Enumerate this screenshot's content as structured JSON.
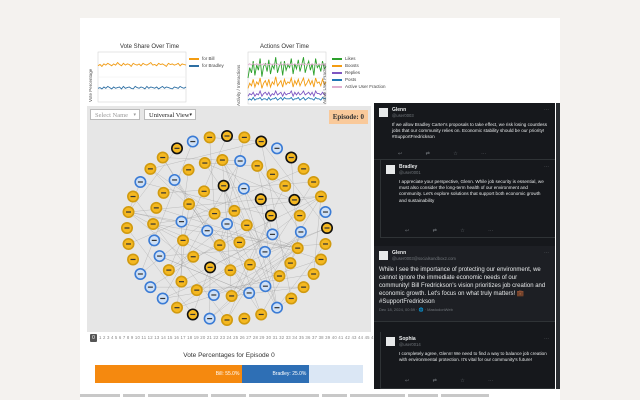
{
  "charts": {
    "vote_share": {
      "title": "Vote Share Over Time",
      "ylabel": "Vote Percentage",
      "legend": [
        "for Bill",
        "for Bradley"
      ],
      "colors": [
        "#f39c12",
        "#2e6fa3"
      ],
      "series": [
        [
          58,
          60,
          57,
          61,
          59,
          62,
          60,
          58,
          61,
          59,
          63,
          60,
          58,
          62,
          59,
          61,
          60,
          57,
          62,
          60,
          59,
          61,
          58,
          62,
          60,
          59,
          61,
          63,
          59,
          60,
          58,
          62,
          60,
          61,
          59,
          57,
          62,
          60,
          61,
          59,
          60,
          62,
          58,
          61,
          60,
          59
        ],
        [
          22,
          23,
          21,
          24,
          22,
          25,
          23,
          21,
          24,
          22,
          23,
          24,
          21,
          25,
          22,
          23,
          24,
          22,
          21,
          25,
          23,
          22,
          24,
          23,
          21,
          25,
          22,
          24,
          23,
          22,
          24,
          21,
          23,
          25,
          22,
          24,
          23,
          22,
          21,
          24,
          23,
          22,
          25,
          23,
          22,
          24
        ]
      ]
    },
    "actions": {
      "title": "Actions Over Time",
      "ylabel": "Activity / Interactions",
      "ylabel2": "Active User Fraction",
      "legend": [
        "Likes",
        "Boosts",
        "Replies",
        "Posts",
        "Active User Fraction"
      ],
      "colors": [
        "#2ca02c",
        "#f39c12",
        "#7e57c2",
        "#1f77b4",
        "#e0b0d0"
      ],
      "series": [
        [
          20,
          28,
          24,
          33,
          22,
          30,
          26,
          35,
          21,
          29,
          31,
          25,
          34,
          23,
          30,
          27,
          36,
          24,
          29,
          32,
          22,
          33,
          26,
          30,
          28,
          35,
          23,
          31,
          27,
          34,
          25,
          30,
          36,
          24,
          29,
          33,
          26,
          31,
          22,
          35,
          28,
          30,
          25,
          33,
          27,
          29
        ],
        [
          12,
          16,
          14,
          19,
          13,
          17,
          15,
          20,
          12,
          16,
          18,
          14,
          19,
          13,
          17,
          15,
          21,
          14,
          16,
          18,
          13,
          19,
          15,
          17,
          16,
          20,
          13,
          18,
          15,
          19,
          14,
          17,
          20,
          14,
          16,
          19,
          15,
          18,
          13,
          20,
          16,
          17,
          14,
          19,
          15,
          17
        ],
        [
          6,
          8,
          7,
          9,
          6,
          8,
          7,
          10,
          6,
          8,
          9,
          7,
          9,
          6,
          8,
          7,
          10,
          7,
          8,
          9,
          6,
          9,
          7,
          8,
          8,
          10,
          6,
          9,
          7,
          9,
          7,
          8,
          10,
          7,
          8,
          9,
          7,
          9,
          6,
          10,
          8,
          8,
          7,
          9,
          7,
          8
        ],
        [
          3,
          4,
          3,
          5,
          3,
          4,
          4,
          5,
          3,
          4,
          4,
          3,
          5,
          3,
          4,
          4,
          5,
          3,
          4,
          5,
          3,
          5,
          4,
          4,
          4,
          5,
          3,
          4,
          4,
          5,
          3,
          4,
          5,
          3,
          4,
          5,
          4,
          4,
          3,
          5,
          4,
          4,
          3,
          5,
          4,
          4
        ],
        [
          30,
          31,
          30,
          31,
          30,
          31,
          30,
          31,
          30,
          31,
          30,
          31,
          30,
          31,
          30,
          31,
          30,
          31,
          30,
          31,
          30,
          31,
          30,
          31,
          30,
          31,
          30,
          31,
          30,
          31,
          30,
          31,
          30,
          31,
          30,
          31,
          30,
          31,
          30,
          31,
          30,
          31,
          30,
          31,
          30,
          31
        ]
      ]
    }
  },
  "network": {
    "select_name": "Select Name",
    "view": "Universal View",
    "episode_label": "Episode: 0",
    "colors": {
      "bill": "#f5b820",
      "bradley": "#3a7bd5",
      "bg": "#e6e6e6",
      "edge": "#9a9a9a"
    }
  },
  "slider": {
    "current": "0",
    "marks": "1 2 3 4 5 6 7 8 9 10 11 12 13 14 15 16 17 18 19 20 21 22 23 24 25 26 27 28 29 30 31 32 33 34 35 36 37 38 39 40 41 42 43 44 45 46 47 48"
  },
  "vote": {
    "title": "Vote Percentages for Episode 0",
    "bill_label": "Bill: 55.0%",
    "bradley_label": "Bradley: 25.0%",
    "bill_pct": 55,
    "bradley_pct": 25,
    "bill_color": "#f5890f",
    "bradley_color": "#2e6fb5",
    "rest_color": "#dbe7f5"
  },
  "feed": [
    {
      "name": "Glenn",
      "handle": "@user0003",
      "body": "If we allow Bradley Carter's proposals to take effect, we risk losing countless jobs that our community relies on. Economic stability should be our priority! #SupportFredrickson"
    },
    {
      "name": "Bradley",
      "handle": "@user0001",
      "body": "I appreciate your perspective, Glenn. While job security is essential, we must also consider the long-term health of our environment and community. Let's explore solutions that support both economic growth and sustainability"
    },
    {
      "name": "Glenn",
      "handle": "@user0003@socialsandbox2.com",
      "body": "While I see the importance of protecting our environment, we cannot ignore the immediate economic needs of our community! Bill Fredrickson's vision prioritizes job creation and economic growth. Let's focus on what truly matters! 💼 #SupportFredrickson",
      "date": "Dec 18, 2024, 00:59 · 🌐 · MastodonWeb"
    },
    {
      "name": "Sophia",
      "handle": "@user0014",
      "body": "I completely agree, Glenn! We need to find a way to balance job creation with environmental protection. It's vital for our community's future!"
    }
  ],
  "icons": {
    "reply": "↩",
    "boost": "⇄",
    "like": "☆",
    "more": "⋯"
  }
}
